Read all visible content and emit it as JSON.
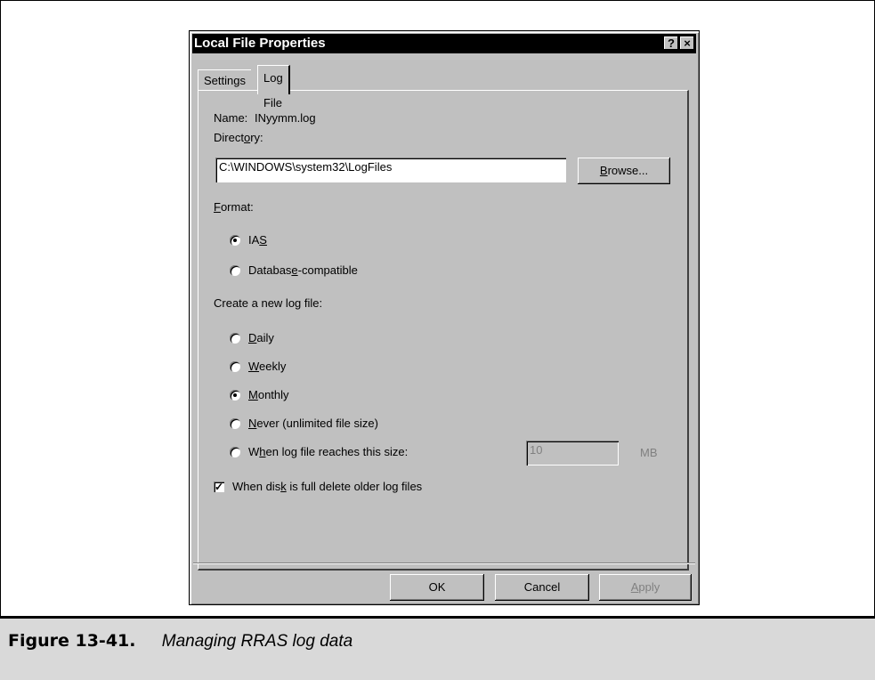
{
  "dialog": {
    "title": "Local File Properties",
    "help_btn": "?",
    "close_btn": "×",
    "tabs": [
      "Settings",
      "Log File"
    ],
    "name_label": "Name:",
    "name_value": "INyymm.log",
    "directory_label": "Directory:",
    "directory_value": "C:\\WINDOWS\\system32\\LogFiles",
    "browse_label": "Browse...",
    "format_label": "Format:",
    "format_options": [
      "IAS",
      "Database-compatible"
    ],
    "format_selected": "IAS",
    "newlog_label": "Create a new log file:",
    "newlog_options": [
      "Daily",
      "Weekly",
      "Monthly",
      "Never (unlimited file size)",
      "When log file reaches this size:"
    ],
    "newlog_selected": "Monthly",
    "size_value": "10",
    "size_unit": "MB",
    "delete_checkbox_label": "When disk is full delete older log files",
    "delete_checked": true,
    "ok": "OK",
    "cancel": "Cancel",
    "apply": "Apply"
  },
  "caption": {
    "figure": "Figure 13-41.",
    "text": "Managing RRAS log data"
  }
}
